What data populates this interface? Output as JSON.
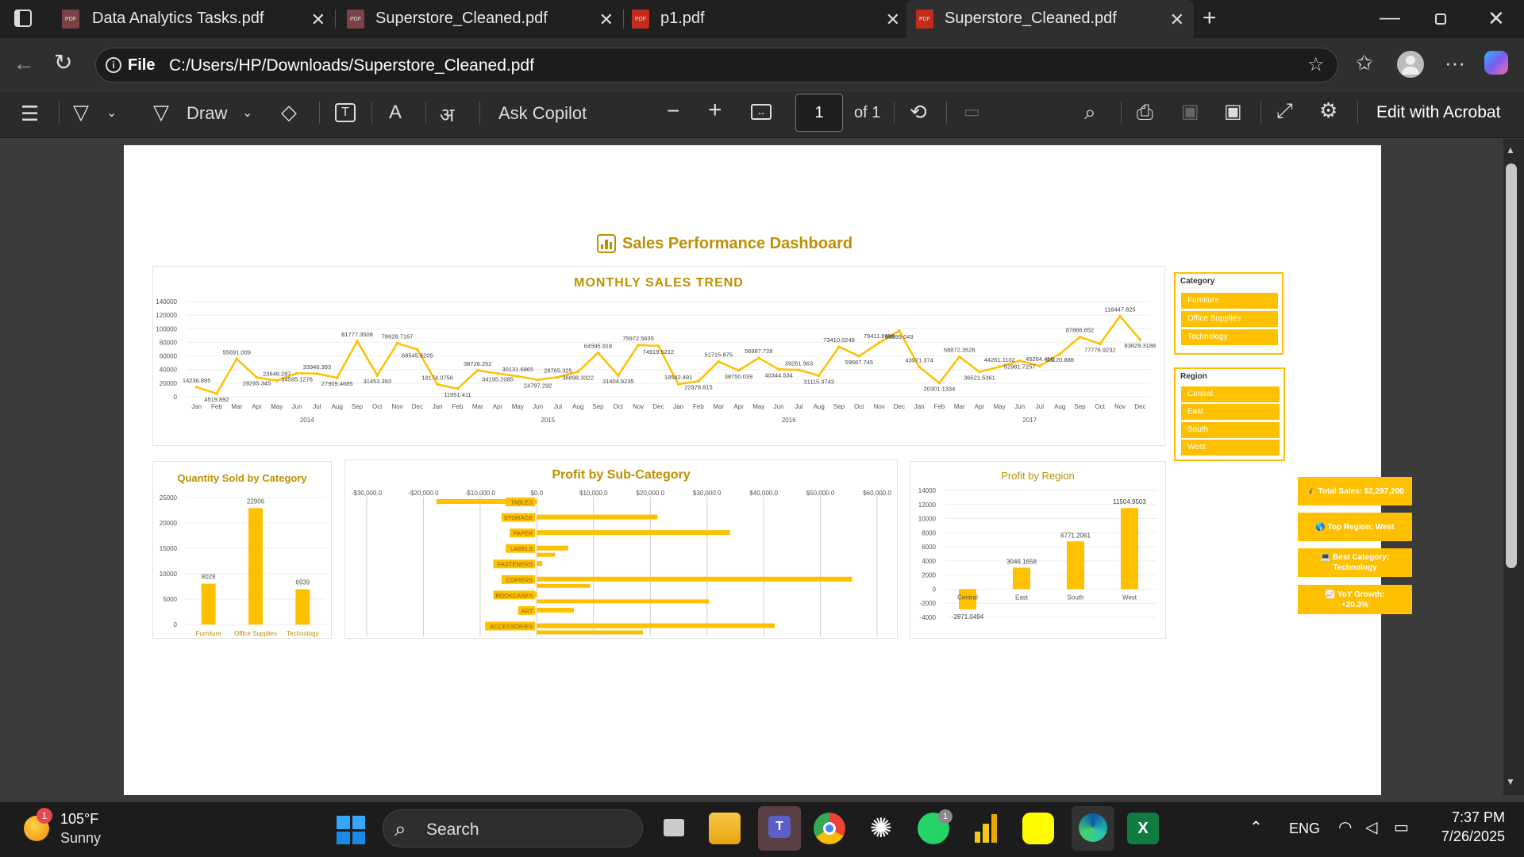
{
  "tabs": [
    {
      "title": "Data Analytics Tasks.pdf"
    },
    {
      "title": "Superstore_Cleaned.pdf"
    },
    {
      "title": "p1.pdf"
    },
    {
      "title": "Superstore_Cleaned.pdf"
    }
  ],
  "pdf_icon_text": "PDF",
  "address": {
    "scheme": "File",
    "path": "C:/Users/HP/Downloads/Superstore_Cleaned.pdf"
  },
  "toolbar": {
    "draw": "Draw",
    "ask_copilot": "Ask Copilot",
    "page": "1",
    "of": "of 1",
    "edit_acrobat": "Edit with Acrobat"
  },
  "dashboard": {
    "title": "Sales Performance Dashboard",
    "monthly": {
      "title": "MONTHLY SALES TREND"
    },
    "qty": {
      "title": "Quantity Sold by Category"
    },
    "subcat": {
      "title": "Profit by Sub-Category"
    },
    "region": {
      "title": "Profit by Region"
    },
    "category_slicer": {
      "title": "Category",
      "items": [
        "Furniture",
        "Office Supplies",
        "Technology"
      ]
    },
    "region_slicer": {
      "title": "Region",
      "items": [
        "Central",
        "East",
        "South",
        "West"
      ]
    },
    "kpis": [
      "💰 Total Sales: $2,297,200",
      "🌎 Top Region: West",
      "💻 Best Category: Technology",
      "📈 YoY Growth: +20.3%"
    ]
  },
  "chart_data": [
    {
      "type": "line",
      "title": "MONTHLY SALES TREND",
      "color": "#ffc000",
      "ylim": [
        0,
        140000
      ],
      "yticks": [
        0,
        20000,
        40000,
        60000,
        80000,
        100000,
        120000,
        140000
      ],
      "month_labels": [
        "Jan",
        "Feb",
        "Mar",
        "Apr",
        "May",
        "Jun",
        "Jul",
        "Aug",
        "Sep",
        "Oct",
        "Nov",
        "Dec"
      ],
      "years": [
        "2014",
        "2015",
        "2016",
        "2017"
      ],
      "values": [
        14236.895,
        4519.892,
        55691.009,
        28295.345,
        23648.287,
        34595.1276,
        33946.393,
        27909.4685,
        81777.3508,
        31453.393,
        78628.7167,
        69545.6205,
        18174.0756,
        11951.411,
        38726.252,
        34195.2085,
        30131.6865,
        24797.292,
        28765.325,
        36898.3322,
        64595.918,
        31404.9235,
        75972.5635,
        74919.5212,
        18542.491,
        22978.815,
        51715.875,
        38750.039,
        56987.728,
        40344.534,
        39261.963,
        31115.3743,
        73410.0249,
        59687.745,
        79411.9658,
        96999.043,
        43971.374,
        20301.1334,
        58872.3528,
        36521.5361,
        44261.1102,
        52981.7257,
        45264.416,
        63120.888,
        87866.652,
        77776.9232,
        118447.825,
        83829.3188
      ],
      "labels": [
        "14236.895",
        "4519.892",
        "55691.009",
        "28295.345",
        "23648.287",
        "34595.1276",
        "33946.393",
        "27909.4685",
        "81777.3508",
        "31453.393",
        "78628.7167",
        "69545.6205",
        "18174.0756",
        "11951.411",
        "38726.252",
        "34195.2085",
        "30131.6865",
        "24797.292",
        "28765.325",
        "36898.3322",
        "64595.918",
        "31404.9235",
        "75972.5635",
        "74919.5212",
        "18542.491",
        "22978.815",
        "51715.875",
        "38750.039",
        "56987.728",
        "40344.534",
        "39261.963",
        "31115.3743",
        "73410.0249",
        "59687.745",
        "79411.9658",
        "96999.043",
        "43971.374",
        "20301.1334",
        "58872.3528",
        "36521.5361",
        "44261.1102",
        "52981.7257",
        "45264.416",
        "63120.888",
        "87866.652",
        "77776.9232",
        "118447.825",
        "83829.3188"
      ]
    },
    {
      "type": "bar",
      "title": "Quantity Sold by Category",
      "color": "#ffc000",
      "categories": [
        "Furniture",
        "Office Supplies",
        "Technology"
      ],
      "values": [
        8028,
        22906,
        6939
      ],
      "ylim": [
        0,
        25000
      ],
      "yticks": [
        0,
        5000,
        10000,
        15000,
        20000,
        25000
      ]
    },
    {
      "type": "bar",
      "orientation": "horizontal",
      "title": "Profit by Sub-Category",
      "color": "#ffc000",
      "categories": [
        "TABLES",
        "STORAGE",
        "PAPER",
        "LABELS",
        "FASTENERS",
        "COPIERS",
        "BOOKCASES",
        "ART",
        "ACCESSORIES"
      ],
      "values": [
        -17725,
        21279,
        34054,
        5546,
        949,
        55618,
        -3473,
        6528,
        41937
      ],
      "extra_values": [
        0,
        0,
        0,
        3200,
        0,
        9400,
        30400,
        0,
        18700
      ],
      "xlim": [
        -30000,
        60000
      ],
      "xticks": [
        "-$30,000.0",
        "-$20,000.0",
        "-$10,000.0",
        "$0.0",
        "$10,000.0",
        "$20,000.0",
        "$30,000.0",
        "$40,000.0",
        "$50,000.0",
        "$60,000.0"
      ]
    },
    {
      "type": "bar",
      "title": "Profit by Region",
      "color": "#ffc000",
      "categories": [
        "Central",
        "East",
        "South",
        "West"
      ],
      "values": [
        -2871.0494,
        3046.1658,
        6771.2061,
        11504.9503
      ],
      "labels": [
        "-2871.0494",
        "3046.1658",
        "6771.2061",
        "11504.9503"
      ],
      "ylim": [
        -4000,
        14000
      ],
      "yticks": [
        -4000,
        -2000,
        0,
        2000,
        4000,
        6000,
        8000,
        10000,
        12000,
        14000
      ]
    }
  ],
  "taskbar": {
    "weather_temp": "105°F",
    "weather_desc": "Sunny",
    "weather_badge": "1",
    "search": "Search",
    "lang": "ENG",
    "time": "7:37 PM",
    "date": "7/26/2025",
    "whatsapp_badge": "1"
  }
}
